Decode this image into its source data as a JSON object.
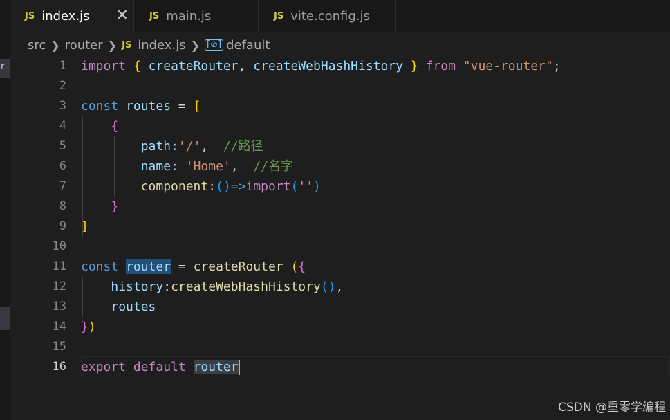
{
  "tabs": [
    {
      "icon": "JS",
      "label": "index.js",
      "active": true,
      "close": "✕"
    },
    {
      "icon": "JS",
      "label": "main.js"
    },
    {
      "icon": "JS",
      "label": "vite.config.js"
    }
  ],
  "breadcrumb": {
    "src": "src",
    "router": "router",
    "file_icon": "JS",
    "file": "index.js",
    "symbol_icon": "[⊘]",
    "symbol": "default"
  },
  "sidebar": {
    "partial_text": "r"
  },
  "editor": {
    "current_line": 16,
    "line_numbers": [
      "1",
      "2",
      "3",
      "4",
      "5",
      "6",
      "7",
      "8",
      "9",
      "10",
      "11",
      "12",
      "13",
      "14",
      "15",
      "16"
    ],
    "tokens": {
      "import": "import",
      "lbrace": "{",
      "createRouter": "createRouter",
      "comma": ",",
      "createWebHashHistory": "createWebHashHistory",
      "rbrace": "}",
      "from": "from",
      "vue_router": "\"vue-router\"",
      "semi": ";",
      "const": "const",
      "routes": "routes",
      "eq": "=",
      "lbracket": "[",
      "path": "path",
      "colon": ":",
      "slash_str": "'/'",
      "comment_path": "//路径",
      "name": "name",
      "home_str": "'Home'",
      "comment_name": "//名字",
      "component": "component",
      "arrow": "=>",
      "lparen": "(",
      "rparen": ")",
      "empty_str": "''",
      "rbracket": "]",
      "router": "router",
      "history": "history",
      "export": "export",
      "default": "default"
    }
  },
  "watermark": "CSDN @重零学编程"
}
